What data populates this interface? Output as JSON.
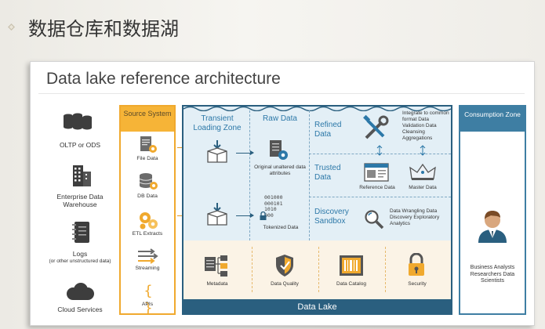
{
  "page_title": "数据仓库和数据湖",
  "slide": {
    "title": "Data lake reference architecture",
    "sources": [
      {
        "label": "OLTP or ODS",
        "sub": ""
      },
      {
        "label": "Enterprise Data Warehouse",
        "sub": ""
      },
      {
        "label": "Logs",
        "sub": "(or other unstructured data)"
      },
      {
        "label": "Cloud Services",
        "sub": ""
      }
    ],
    "source_system": {
      "header": "Source System",
      "items": [
        "File Data",
        "DB Data",
        "ETL Extracts",
        "Streaming",
        "APIs"
      ]
    },
    "lake": {
      "transient": "Transient Loading Zone",
      "raw": "Raw Data",
      "raw_desc": "Original unaltered data attributes",
      "tokenized_bits": "001000\n000101\n1010\n000",
      "tokenized": "Tokenized Data",
      "refined": "Refined Data",
      "refined_desc": "Integrate to common format Data Validation Data Cleansing Aggregations",
      "trusted": "Trusted Data",
      "reference": "Reference Data",
      "master": "Master Data",
      "discovery": "Discovery Sandbox",
      "discovery_desc": "Data Wrangling Data Discovery Exploratory Analytics",
      "governance": [
        "Metadata",
        "Data Quality",
        "Data Catalog",
        "Security"
      ],
      "footer": "Data Lake"
    },
    "consumption": {
      "header": "Consumption Zone",
      "users": "Business Analysts Researchers Data Scientists"
    }
  },
  "colors": {
    "orange": "#f6b437",
    "navy": "#2a5f7f",
    "lake_bg": "#e3eff6",
    "accent_blue": "#2c78a8"
  }
}
